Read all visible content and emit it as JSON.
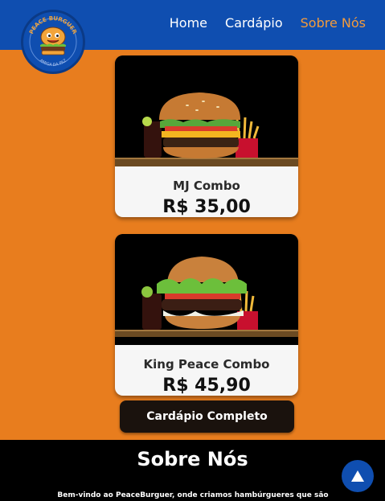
{
  "header": {
    "logo_top_text": "PEACE BURGUER",
    "logo_bottom_text": "AMIGA DA PAZ",
    "nav": [
      {
        "label": "Home"
      },
      {
        "label": "Cardápio"
      },
      {
        "label": "Sobre Nós",
        "active": true
      }
    ]
  },
  "cards": [
    {
      "name": "MJ Combo",
      "price": "R$ 35,00"
    },
    {
      "name": "King Peace Combo",
      "price": "R$ 45,90"
    }
  ],
  "menu_button": {
    "label": "Cardápio Completo"
  },
  "about": {
    "title": "Sobre Nós",
    "text": "Bem-vindo ao PeaceBurguer, onde criamos hambúrgueres que são verdadeiras"
  },
  "colors": {
    "header": "#0F4EB0",
    "background": "#E87D1E",
    "nav_active": "#F39B3C",
    "footer": "#000000",
    "button": "#1A120D"
  },
  "icons": {
    "back_to_top": "arrow-up-icon"
  }
}
